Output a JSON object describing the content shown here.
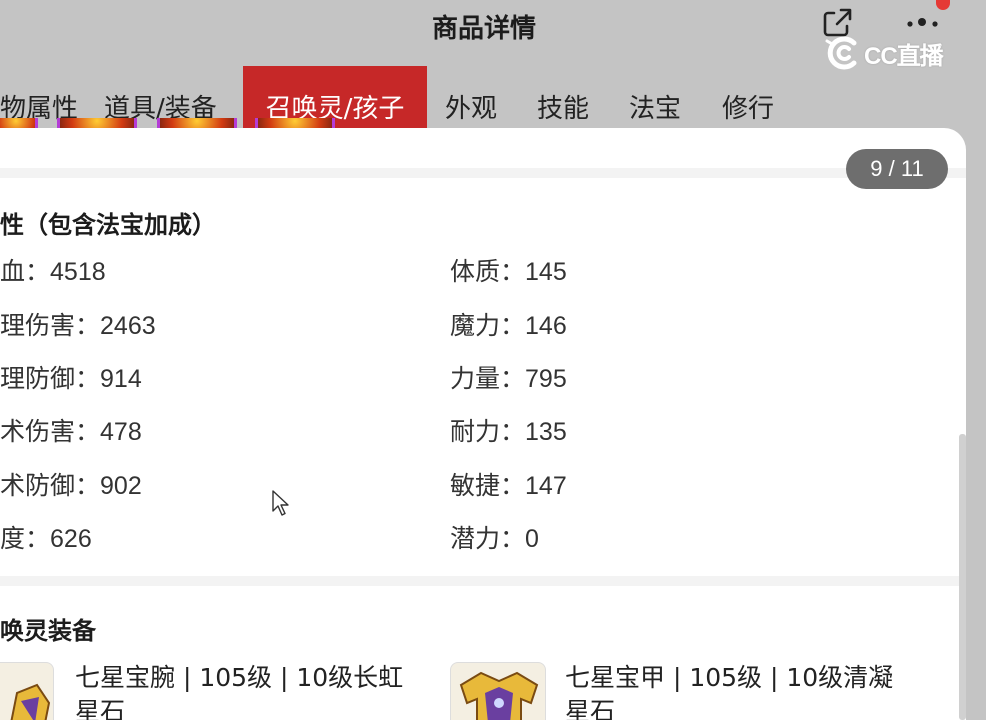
{
  "header": {
    "title": "商品详情",
    "brand": "CC直播"
  },
  "tabs": [
    {
      "label": "物属性",
      "active": false
    },
    {
      "label": "道具/装备",
      "active": false
    },
    {
      "label": "召唤灵/孩子",
      "active": true
    },
    {
      "label": "外观",
      "active": false
    },
    {
      "label": "技能",
      "active": false
    },
    {
      "label": "法宝",
      "active": false
    },
    {
      "label": "修行",
      "active": false
    }
  ],
  "image_counter": "9 / 11",
  "attributes": {
    "title": "性（包含法宝加成）",
    "left": [
      {
        "label": "血：",
        "value": "4518"
      },
      {
        "label": "理伤害：",
        "value": "2463"
      },
      {
        "label": "理防御：",
        "value": "914"
      },
      {
        "label": "术伤害：",
        "value": "478"
      },
      {
        "label": "术防御：",
        "value": "902"
      },
      {
        "label": "度：",
        "value": "626"
      }
    ],
    "right": [
      {
        "label": "体质：",
        "value": "145"
      },
      {
        "label": "魔力：",
        "value": "146"
      },
      {
        "label": "力量：",
        "value": "795"
      },
      {
        "label": "耐力：",
        "value": "135"
      },
      {
        "label": "敏捷：",
        "value": "147"
      },
      {
        "label": "潜力：",
        "value": "0"
      }
    ]
  },
  "equipment": {
    "title": "唤灵装备",
    "items": [
      {
        "line1": "七星宝腕 | 105级 | 10级长虹",
        "line2": "星石"
      },
      {
        "line1": "七星宝甲 | 105级 | 10级清凝",
        "line2": "星石"
      }
    ]
  },
  "colors": {
    "active_tab": "#c62828",
    "header_bg": "#c4c4c4",
    "counter_bg": "#6e6e6e",
    "thumb_border": "#b43cd6"
  }
}
